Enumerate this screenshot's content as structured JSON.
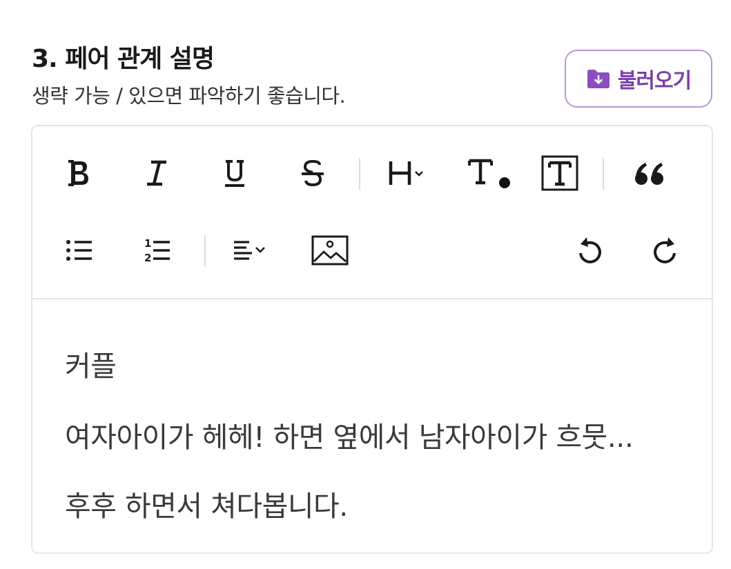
{
  "section": {
    "title": "3. 페어 관계 설명",
    "subtitle": "생략 가능 / 있으면 파악하기 좋습니다."
  },
  "load_button": {
    "label": "불러오기",
    "icon": "folder-download-icon",
    "accent_color": "#7a3fa8",
    "border_color": "#b896d4"
  },
  "toolbar": {
    "row1": [
      "bold-icon",
      "italic-icon",
      "underline-icon",
      "strikethrough-icon",
      "heading-icon",
      "text-color-icon",
      "text-background-icon",
      "quote-icon"
    ],
    "row2": [
      "bulleted-list-icon",
      "numbered-list-icon",
      "align-icon",
      "image-icon",
      "undo-icon",
      "redo-icon"
    ],
    "numbered_list_glyphs": {
      "one": "1",
      "two": "2"
    }
  },
  "editor": {
    "lines": [
      "커플",
      "여자아이가 헤헤! 하면 옆에서 남자아이가 흐뭇...",
      "후후 하면서 쳐다봅니다."
    ]
  }
}
